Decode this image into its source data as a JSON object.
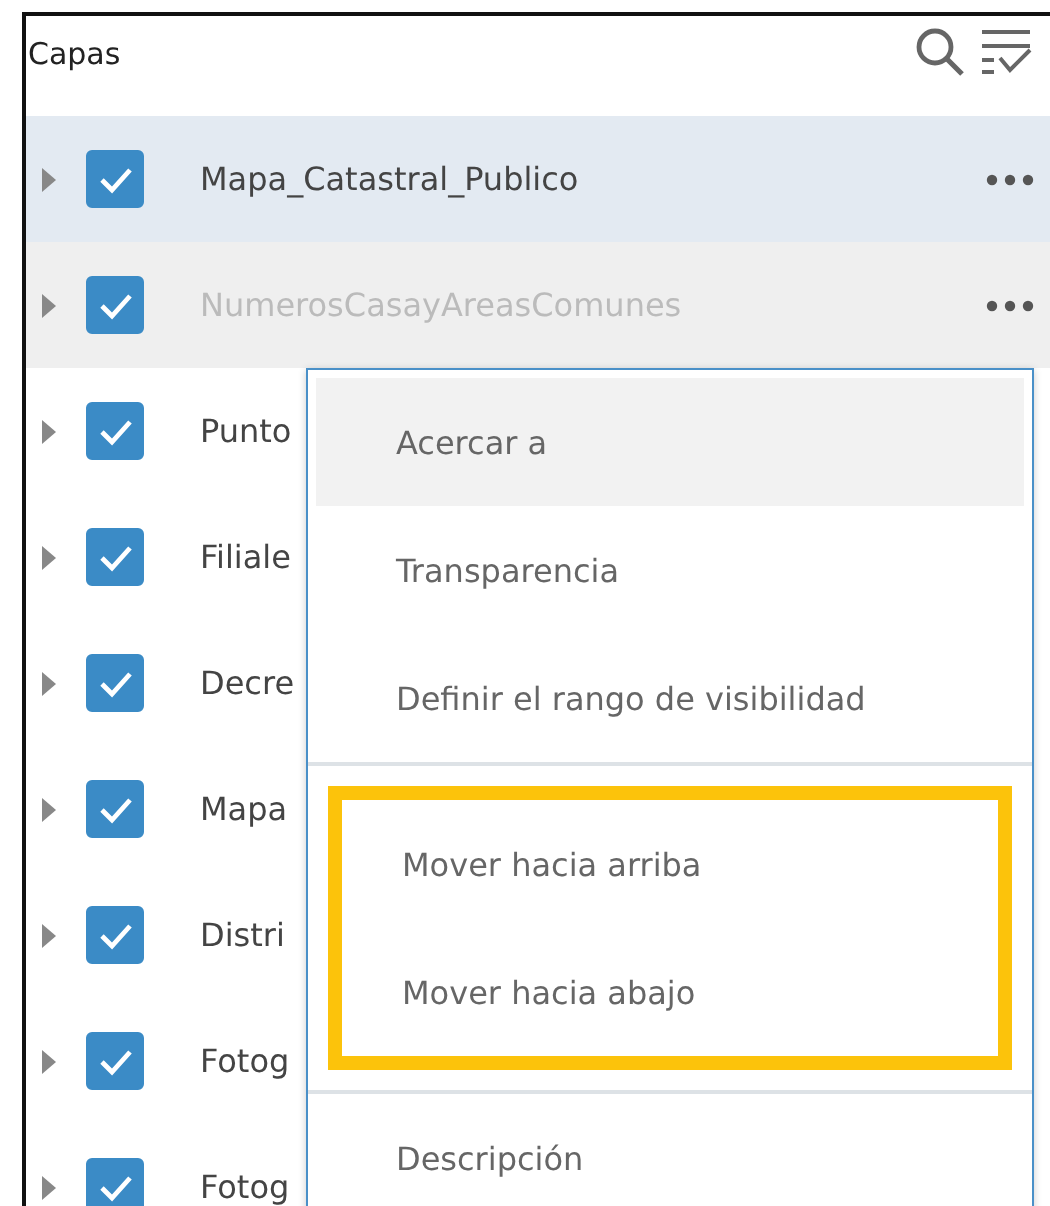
{
  "panel": {
    "title": "Capas"
  },
  "layers": [
    {
      "name": "Mapa_Catastral_Publico",
      "checked": true,
      "selected": true,
      "hovered": false,
      "dimmed": false,
      "has_menu": true
    },
    {
      "name": "NumerosCasayAreasComunes",
      "checked": true,
      "selected": false,
      "hovered": true,
      "dimmed": true,
      "has_menu": true
    },
    {
      "name": "Punto",
      "checked": true,
      "selected": false,
      "hovered": false,
      "dimmed": false
    },
    {
      "name": "Filiale",
      "checked": true,
      "selected": false,
      "hovered": false,
      "dimmed": false
    },
    {
      "name": "Decre",
      "checked": true,
      "selected": false,
      "hovered": false,
      "dimmed": false
    },
    {
      "name": "Mapa",
      "checked": true,
      "selected": false,
      "hovered": false,
      "dimmed": false
    },
    {
      "name": "Distri",
      "checked": true,
      "selected": false,
      "hovered": false,
      "dimmed": false
    },
    {
      "name": "Fotog",
      "checked": true,
      "selected": false,
      "hovered": false,
      "dimmed": false
    },
    {
      "name": "Fotog",
      "checked": true,
      "selected": false,
      "hovered": false,
      "dimmed": false
    }
  ],
  "context_menu": {
    "sections": [
      {
        "outlined": false,
        "items": [
          {
            "label": "Acercar a",
            "hovered": true
          },
          {
            "label": "Transparencia",
            "hovered": false
          },
          {
            "label": "Definir el rango de visibilidad",
            "hovered": false
          }
        ]
      },
      {
        "outlined": true,
        "items": [
          {
            "label": "Mover hacia arriba",
            "hovered": false
          },
          {
            "label": "Mover hacia abajo",
            "hovered": false
          }
        ]
      },
      {
        "outlined": false,
        "items": [
          {
            "label": "Descripción",
            "hovered": false
          }
        ]
      }
    ]
  }
}
